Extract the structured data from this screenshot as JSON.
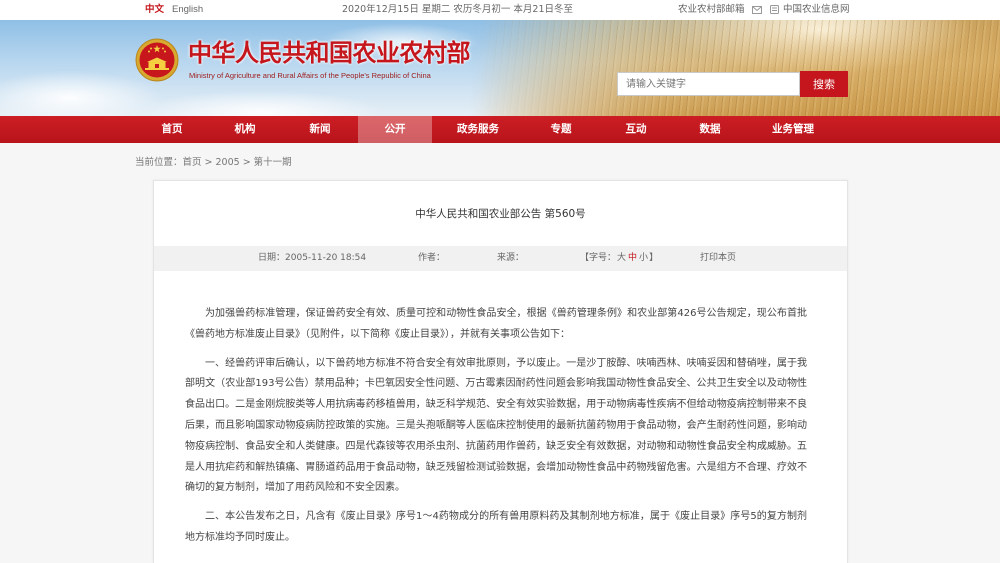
{
  "topbar": {
    "lang_zh": "中文",
    "lang_en": "English",
    "date": "2020年12月15日 星期二 农历冬月初一 本月21日冬至",
    "mail_link": "农业农村部邮箱",
    "mail_icon": "mail-icon",
    "info_link": "中国农业信息网",
    "info_icon": "website-icon"
  },
  "header": {
    "emblem_icon": "national-emblem-icon",
    "title": "中华人民共和国农业农村部",
    "subtitle": "Ministry of Agriculture and Rural Affairs of the People's Republic of China",
    "search_placeholder": "请输入关键字",
    "search_button": "搜索"
  },
  "nav": {
    "items": [
      "首页",
      "机构",
      "新闻",
      "公开",
      "政务服务",
      "专题",
      "互动",
      "数据",
      "业务管理"
    ],
    "active_index": 3
  },
  "breadcrumb": {
    "label": "当前位置：",
    "items": [
      "首页",
      "2005",
      "第十一期"
    ],
    "separator": ">"
  },
  "article": {
    "title": "中华人民共和国农业部公告 第560号",
    "meta": {
      "date_label": "日期：",
      "date": "2005-11-20 18:54",
      "author_label": "作者：",
      "source_label": "来源：",
      "font_size_open": "【字号：",
      "font_sizes": [
        "大",
        "中",
        "小"
      ],
      "font_size_close": "】",
      "print": "打印本页"
    },
    "paragraphs": [
      "为加强兽药标准管理，保证兽药安全有效、质量可控和动物性食品安全，根据《兽药管理条例》和农业部第426号公告规定，现公布首批《兽药地方标准废止目录》（见附件，以下简称《废止目录》），并就有关事项公告如下：",
      "一、经兽药评审后确认，以下兽药地方标准不符合安全有效审批原则，予以废止。一是沙丁胺醇、呋喃西林、呋喃妥因和替硝唑，属于我部明文（农业部193号公告）禁用品种；卡巴氧因安全性问题、万古霉素因耐药性问题会影响我国动物性食品安全、公共卫生安全以及动物性食品出口。二是金刚烷胺类等人用抗病毒药移植兽用，缺乏科学规范、安全有效实验数据，用于动物病毒性疾病不但给动物疫病控制带来不良后果，而且影响国家动物疫病防控政策的实施。三是头孢哌酮等人医临床控制使用的最新抗菌药物用于食品动物，会产生耐药性问题，影响动物疫病控制、食品安全和人类健康。四是代森铵等农用杀虫剂、抗菌药用作兽药，缺乏安全有效数据，对动物和动物性食品安全构成威胁。五是人用抗疟药和解热镇痛、胃肠道药品用于食品动物，缺乏残留检测试验数据，会增加动物性食品中药物残留危害。六是组方不合理、疗效不确切的复方制剂，增加了用药风险和不安全因素。",
      "二、本公告发布之日，凡含有《废止目录》序号1～4药物成分的所有兽用原料药及其制剂地方标准，属于《废止目录》序号5的复方制剂地方标准均予同时废止。"
    ]
  },
  "colors": {
    "brand_red": "#c4161c",
    "nav_red": "#b8141b",
    "info_bar_bg": "#f1f1f1"
  }
}
